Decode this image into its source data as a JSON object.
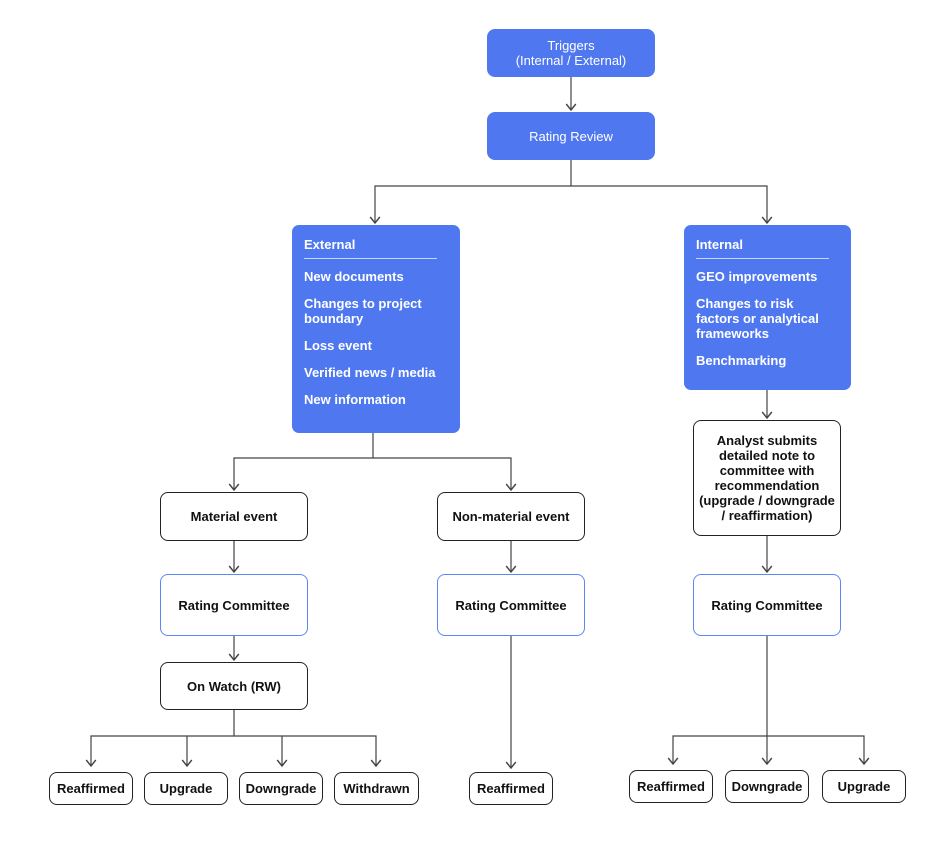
{
  "colors": {
    "accent": "#4f78f0",
    "line": "#444444"
  },
  "triggers": "Triggers\n(Internal / External)",
  "rating_review": "Rating Review",
  "external": {
    "title": "External",
    "items": [
      "New documents",
      "Changes to project boundary",
      "Loss event",
      "Verified news / media",
      "New information"
    ]
  },
  "internal": {
    "title": "Internal",
    "items": [
      "GEO improvements",
      "Changes to risk factors or analytical frameworks",
      "Benchmarking"
    ]
  },
  "material_event": "Material event",
  "non_material_event": "Non-material event",
  "analyst_note": "Analyst submits detailed note to committee with recommendation (upgrade / downgrade / reaffirmation)",
  "rating_committee": "Rating Committee",
  "on_watch": "On Watch (RW)",
  "outcomes_material": [
    "Reaffirmed",
    "Upgrade",
    "Downgrade",
    "Withdrawn"
  ],
  "outcomes_non_material": [
    "Reaffirmed"
  ],
  "outcomes_internal": [
    "Reaffirmed",
    "Downgrade",
    "Upgrade"
  ]
}
